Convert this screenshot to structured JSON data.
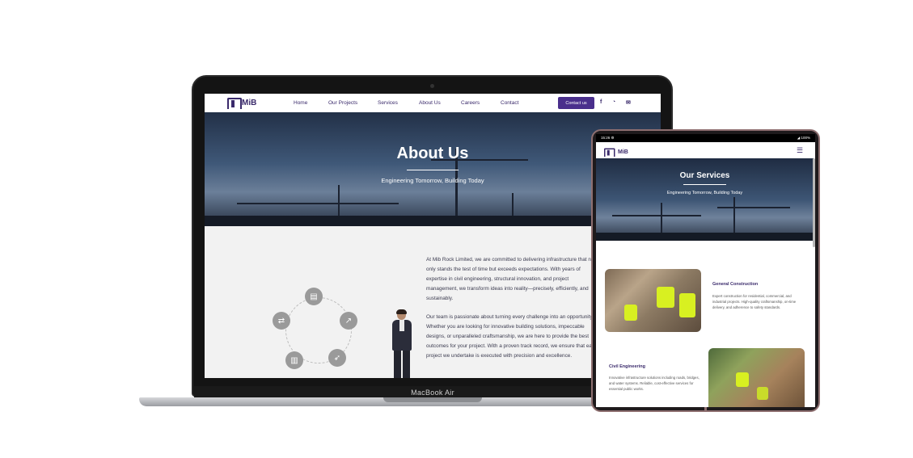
{
  "laptop": {
    "brand": "MacBook Air",
    "site": {
      "logo": "MiB",
      "nav": [
        "Home",
        "Our Projects",
        "Services",
        "About Us",
        "Careers",
        "Contact"
      ],
      "contact_button": "Contact us",
      "hero_title": "About Us",
      "hero_subtitle": "Engineering Tomorrow, Building Today",
      "body": [
        "At Mib Rock Limited, we are committed to delivering infrastructure that not only stands the test of time but exceeds expectations. With years of expertise in civil engineering, structural innovation, and project management, we transform ideas into reality—precisely, efficiently, and sustainably.",
        "Our team is passionate about turning every challenge into an opportunity. Whether you are looking for innovative building solutions, impeccable designs, or unparalleled craftsmanship, we are here to provide the best outcomes for your project. With a proven track record, we ensure that each project we undertake is executed with precision and excellence."
      ],
      "icons": [
        "document-icon",
        "wrench-icon",
        "rocket-icon",
        "chart-icon",
        "swap-icon"
      ]
    }
  },
  "tablet": {
    "status_left": "15:26 ⚙",
    "status_right": "◢ 100%",
    "logo": "MiB",
    "hero_title": "Our Services",
    "hero_subtitle": "Engineering Tomorrow, Building Today",
    "services": [
      {
        "title": "General Construction",
        "desc": "Expert construction for residential, commercial, and industrial projects. High-quality craftsmanship, on-time delivery, and adherence to safety standards."
      },
      {
        "title": "Civil Engineering",
        "desc": "Innovative infrastructure solutions including roads, bridges, and water systems. Reliable, cost-effective services for essential public works."
      }
    ]
  },
  "colors": {
    "brand": "#4a2f8c",
    "text_dark": "#3a2a6b"
  }
}
